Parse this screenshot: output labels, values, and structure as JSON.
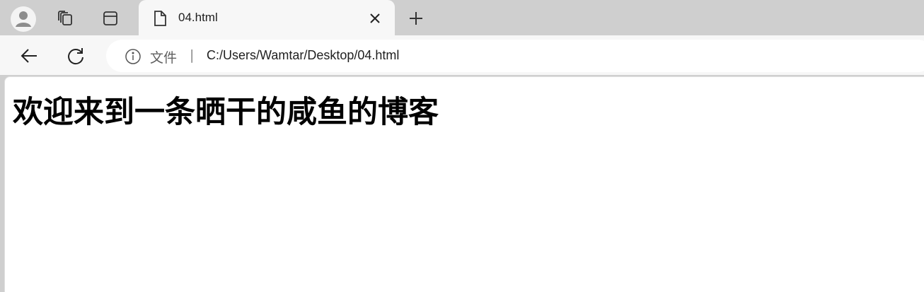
{
  "browser": {
    "tab": {
      "title": "04.html"
    },
    "addressbar": {
      "scheme_label": "文件",
      "separator": "|",
      "url": "C:/Users/Wamtar/Desktop/04.html"
    }
  },
  "page": {
    "heading": "欢迎来到一条晒干的咸鱼的博客"
  },
  "icons": {
    "profile": "profile-avatar-icon",
    "tab_actions": "workspaces-icon",
    "vertical_tabs": "vertical-tabs-icon",
    "tab_file": "file-icon",
    "close": "close-icon",
    "new_tab": "plus-icon",
    "back": "arrow-left-icon",
    "reload": "reload-icon",
    "info": "info-icon"
  },
  "colors": {
    "tabstrip_bg": "#cfcfcf",
    "toolbar_bg": "#f7f7f7",
    "page_bg": "#ffffff"
  }
}
